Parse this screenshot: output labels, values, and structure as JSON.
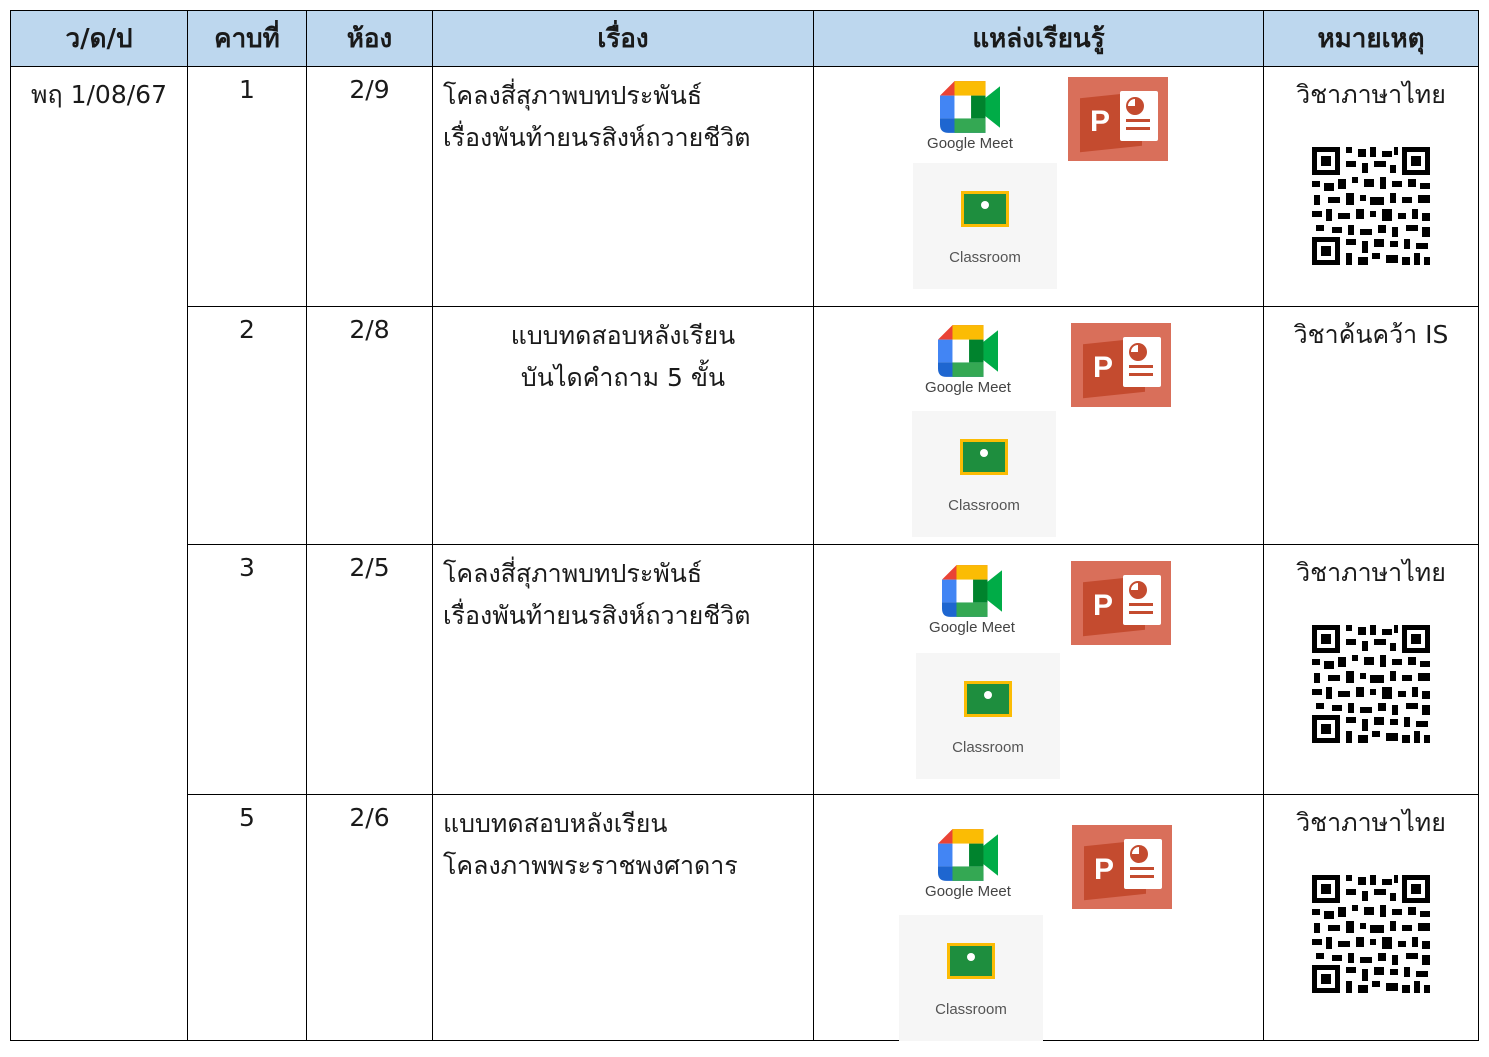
{
  "headers": [
    "ว/ด/ป",
    "คาบที่",
    "ห้อง",
    "เรื่อง",
    "แหล่งเรียนรู้",
    "หมายเหตุ"
  ],
  "date": "พฤ 1/08/67",
  "resources": {
    "meet_label": "Google Meet",
    "classroom_label": "Classroom"
  },
  "rows": [
    {
      "period": "1",
      "room": "2/9",
      "topic_line1": "โคลงสี่สุภาพบทประพันธ์",
      "topic_line2": "เรื่องพันท้ายนรสิงห์ถวายชีวิต",
      "note": "วิชาภาษาไทย"
    },
    {
      "period": "2",
      "room": "2/8",
      "topic_line1": "แบบทดสอบหลังเรียน",
      "topic_line2": "บันไดคำถาม 5 ขั้น",
      "note": "วิชาค้นคว้า IS"
    },
    {
      "period": "3",
      "room": "2/5",
      "topic_line1": "โคลงสี่สุภาพบทประพันธ์",
      "topic_line2": "เรื่องพันท้ายนรสิงห์ถวายชีวิต",
      "note": "วิชาภาษาไทย"
    },
    {
      "period": "5",
      "room": "2/6",
      "topic_line1": "แบบทดสอบหลังเรียน",
      "topic_line2": "โคลงภาพพระราชพงศาดาร",
      "note": "วิชาภาษาไทย"
    }
  ]
}
